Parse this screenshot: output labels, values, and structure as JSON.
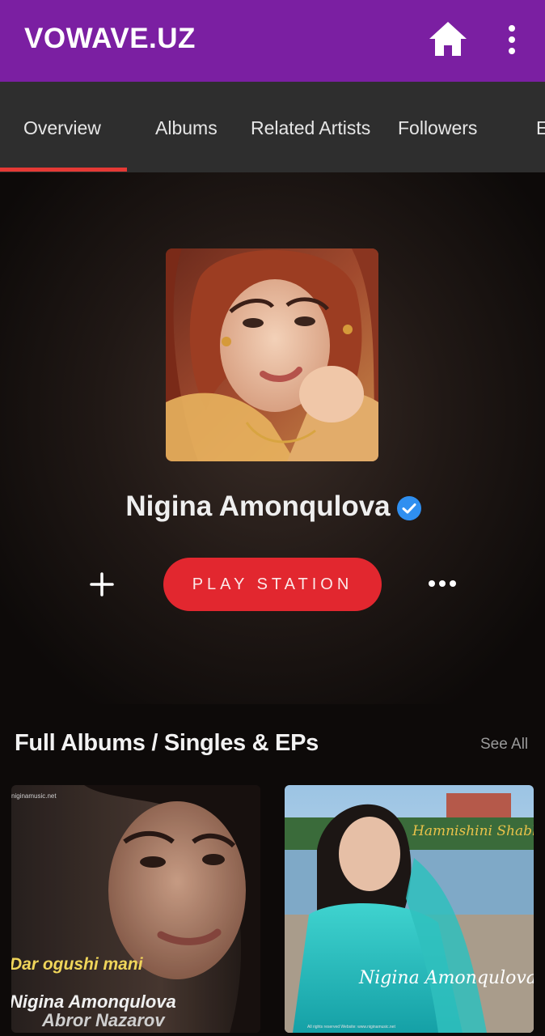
{
  "appbar": {
    "title": "VOWAVE.UZ",
    "home_icon": "home-icon",
    "menu_icon": "more-vertical-icon",
    "color": "#7b1fa2"
  },
  "tabs": [
    {
      "label": "Overview",
      "active": true
    },
    {
      "label": "Albums"
    },
    {
      "label": "Related Artists"
    },
    {
      "label": "Followers"
    },
    {
      "label": "E"
    }
  ],
  "artist": {
    "name": "Nigina Amonqulova",
    "verified_icon": "verified-check-icon",
    "photo_icon": "artist-photo"
  },
  "actions": {
    "add_icon": "plus-icon",
    "play_label": "PLAY STATION",
    "more_icon": "more-horizontal-icon",
    "accent": "#e2272f"
  },
  "section": {
    "title": "Full Albums / Singles & EPs",
    "see_all": "See All"
  },
  "albums": [
    {
      "cover_text_1": "Dar ogushi mani",
      "cover_text_2": "Nigina Amonqulova",
      "cover_text_3": "Abror Nazarov",
      "cover_small": "niginamusic.net"
    },
    {
      "cover_text_1": "Hamnishini Shabha",
      "cover_text_2": "Nigina Amonqulova",
      "cover_small": "All rights reserved   Website: www.niginamusic.net"
    }
  ]
}
